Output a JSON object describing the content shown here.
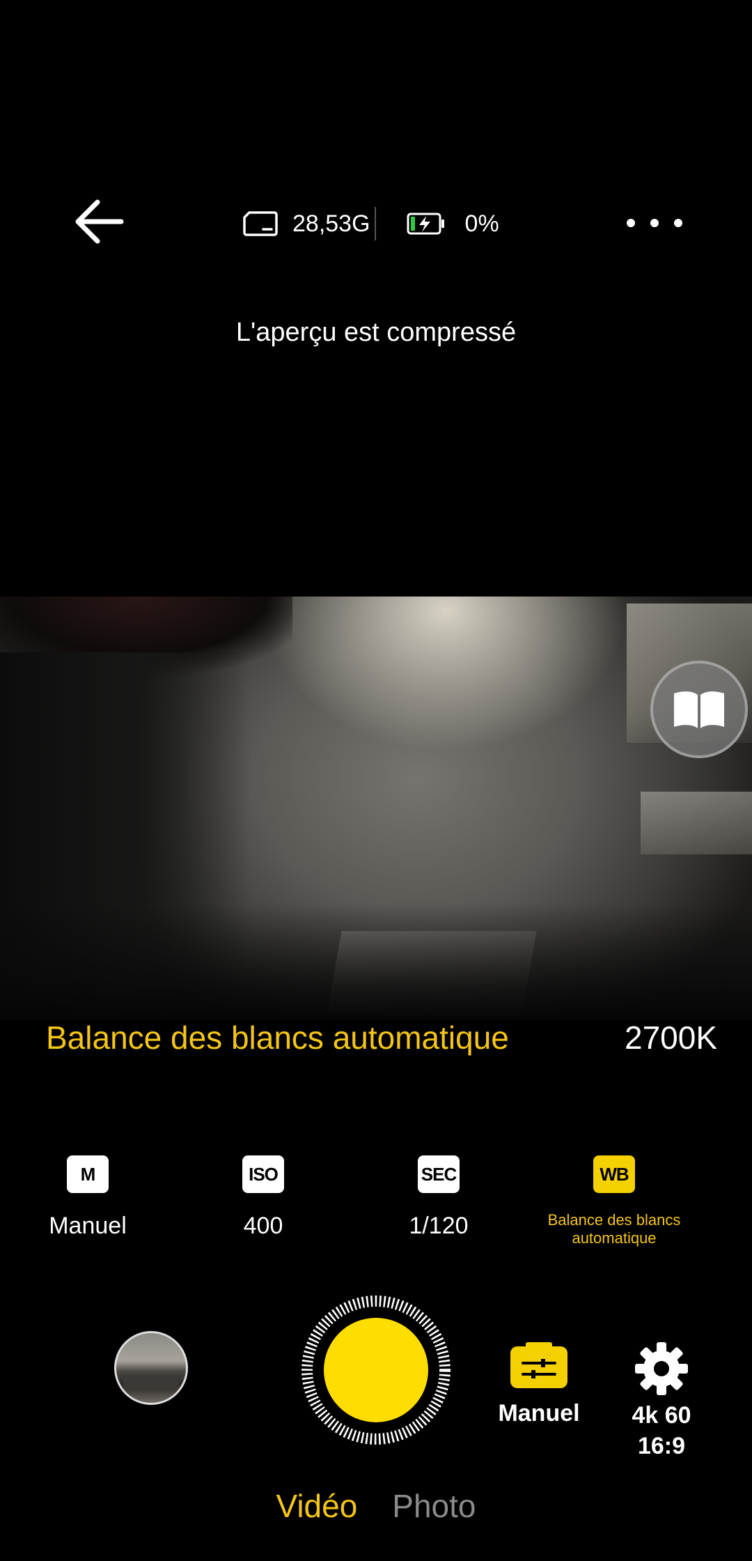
{
  "status": {
    "storage": "28,53G",
    "battery": "0%"
  },
  "notice": "L'aperçu est compressé",
  "white_balance": {
    "title": "Balance des blancs automatique",
    "value": "2700K"
  },
  "params": [
    {
      "badge": "M",
      "value": "Manuel"
    },
    {
      "badge": "ISO",
      "value": "400"
    },
    {
      "badge": "SEC",
      "value": "1/120"
    },
    {
      "badge": "WB",
      "value": "Balance des blancs automatique"
    }
  ],
  "controls": {
    "mode_label": "Manuel",
    "settings_line1": "4k 60",
    "settings_line2": "16:9"
  },
  "tabs": [
    "Vidéo",
    "Photo"
  ],
  "colors": {
    "accent": "#f5c518",
    "shutter": "#ffdd00"
  }
}
